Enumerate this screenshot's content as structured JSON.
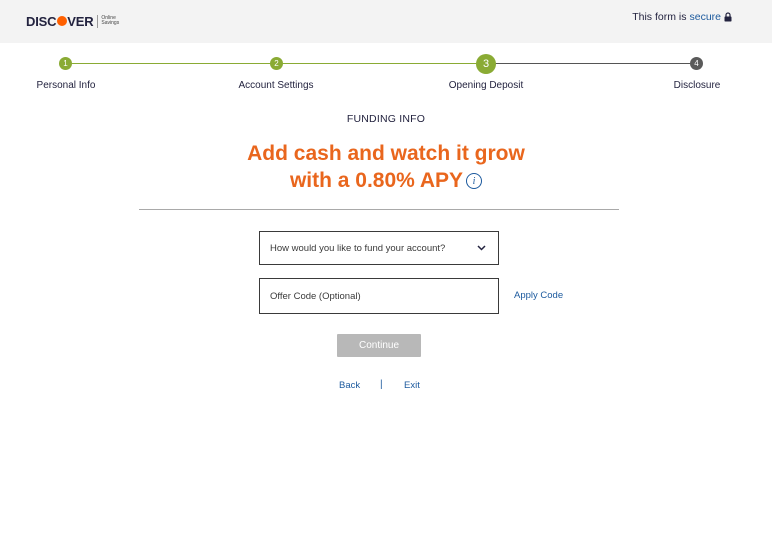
{
  "header": {
    "logo_word": [
      "DISC",
      "VER"
    ],
    "logo_sub": [
      "Online",
      "Savings"
    ],
    "secure_prefix": "This form is",
    "secure_link": "secure"
  },
  "stepper": {
    "steps": [
      {
        "number": "1",
        "label": "Personal Info",
        "state": "done"
      },
      {
        "number": "2",
        "label": "Account Settings",
        "state": "done"
      },
      {
        "number": "3",
        "label": "Opening Deposit",
        "state": "current"
      },
      {
        "number": "4",
        "label": "Disclosure",
        "state": "todo"
      }
    ]
  },
  "main": {
    "section_title": "FUNDING INFO",
    "headline_line1": "Add cash and watch it grow",
    "headline_line2": "with a 0.80% APY",
    "info_icon_glyph": "i",
    "funding_select": {
      "value": "How would you like to fund your account?"
    },
    "offer_code": {
      "placeholder": "Offer Code (Optional)"
    },
    "apply_code_label": "Apply Code",
    "continue_label": "Continue",
    "back_label": "Back",
    "separator": "|",
    "exit_label": "Exit"
  },
  "colors": {
    "accent_orange": "#e9661d",
    "step_green": "#8aab34",
    "link_blue": "#1c5a9e",
    "button_disabled": "#b8b8b8"
  },
  "icons": {
    "lock": "lock-icon",
    "info": "info-icon",
    "chevron": "chevron-down-icon"
  }
}
